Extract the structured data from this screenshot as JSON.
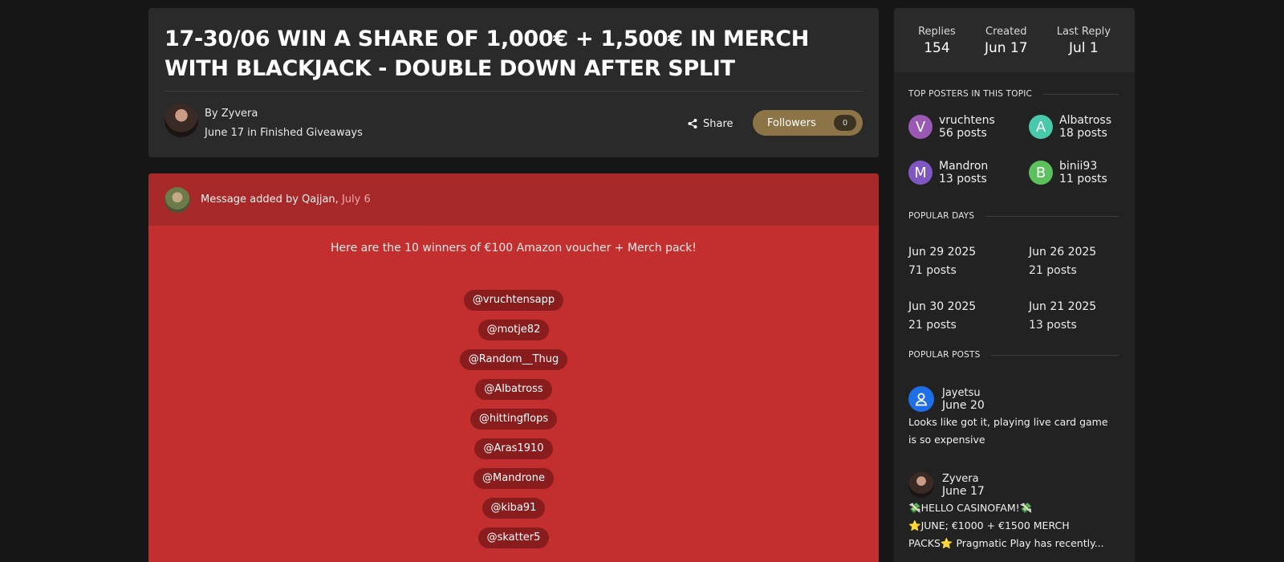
{
  "topic": {
    "title": "17-30/06 WIN A SHARE OF 1,000€ + 1,500€ IN MERCH WITH BLACKJACK - DOUBLE DOWN AFTER SPLIT",
    "author_line": "By Zyvera",
    "meta_line": "June 17 in Finished Giveaways",
    "share_label": "Share",
    "followers_label": "Followers",
    "followers_count": "0"
  },
  "message": {
    "added_text": "Message added by Qajjan,",
    "added_date": "July 6",
    "intro": "Here are the 10 winners of €100 Amazon voucher + Merch pack!",
    "winners": [
      "@vruchtensapp",
      "@motje82",
      "@Random__Thug",
      "@Albatross",
      "@hittingflops",
      "@Aras1910",
      "@Mandrone",
      "@kiba91",
      "@skatter5"
    ]
  },
  "stats": {
    "replies_label": "Replies",
    "replies_value": "154",
    "created_label": "Created",
    "created_value": "Jun 17",
    "last_reply_label": "Last Reply",
    "last_reply_value": "Jul 1"
  },
  "sidebar": {
    "top_posters_heading": "TOP POSTERS IN THIS TOPIC",
    "top_posters": [
      {
        "initial": "V",
        "name": "vruchtens",
        "posts": "56 posts",
        "color": "#9b59b6"
      },
      {
        "initial": "A",
        "name": "Albatross",
        "posts": "18 posts",
        "color": "#48c9a9"
      },
      {
        "initial": "M",
        "name": "Mandron",
        "posts": "13 posts",
        "color": "#7e57c2"
      },
      {
        "initial": "B",
        "name": "binii93",
        "posts": "11 posts",
        "color": "#5cc05c"
      }
    ],
    "popular_days_heading": "POPULAR DAYS",
    "popular_days": [
      {
        "date": "Jun 29 2025",
        "posts": "71 posts"
      },
      {
        "date": "Jun 26 2025",
        "posts": "21 posts"
      },
      {
        "date": "Jun 30 2025",
        "posts": "21 posts"
      },
      {
        "date": "Jun 21 2025",
        "posts": "13 posts"
      }
    ],
    "popular_posts_heading": "POPULAR POSTS",
    "popular_posts": [
      {
        "author": "Jayetsu",
        "date": "June 20",
        "excerpt": "Looks like got it, playing live card game is so expensive"
      },
      {
        "author": "Zyvera",
        "date": "June 17",
        "excerpt_line1": "💸HELLO CASINOFAM!💸",
        "excerpt_line2": "⭐JUNE; €1000 + €1500 MERCH",
        "excerpt_line3": "PACKS⭐ Pragmatic Play has recently..."
      }
    ]
  }
}
